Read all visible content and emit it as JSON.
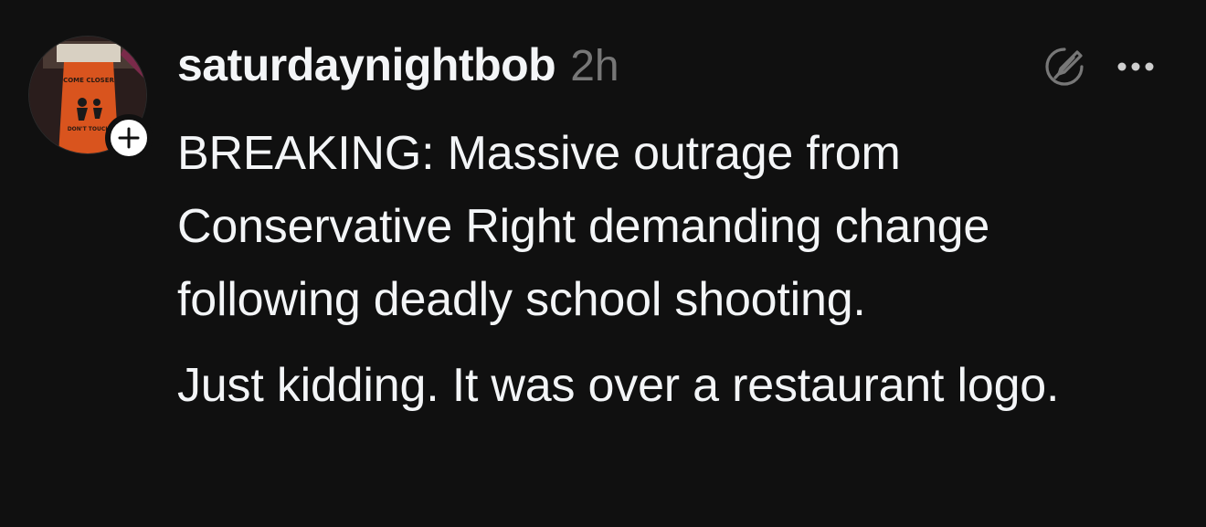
{
  "post": {
    "username": "saturdaynightbob",
    "timestamp": "2h",
    "avatar": {
      "sign_text_top": "COME CLOSER",
      "sign_text_bottom": "DON'T TOUCH"
    },
    "follow_icon": "plus-icon",
    "action_icons": [
      "compose-icon",
      "more-icon"
    ],
    "paragraphs": [
      "BREAKING: Massive outrage from Conservative Right demanding change following deadly school shooting.",
      "Just kidding. It was over a restaurant logo."
    ]
  },
  "colors": {
    "background": "#101010",
    "text": "#f3f5f7",
    "muted": "#777777"
  }
}
